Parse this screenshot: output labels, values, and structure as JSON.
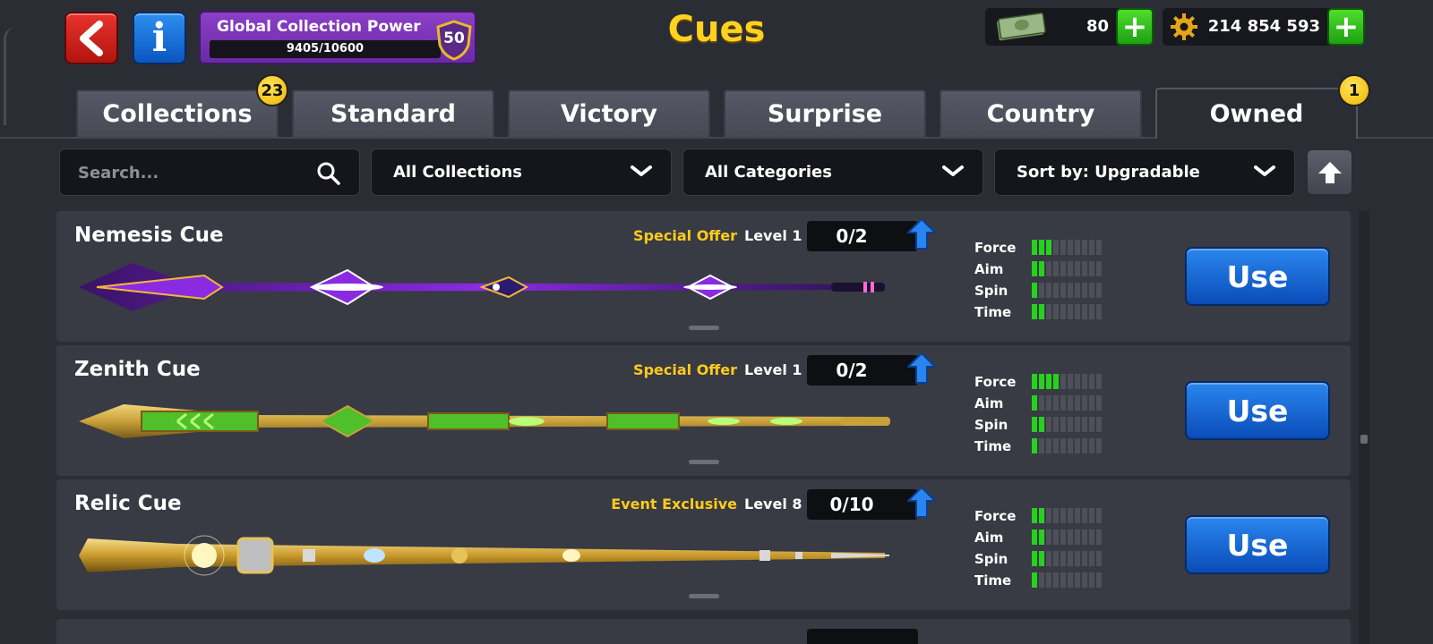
{
  "header": {
    "title": "Cues",
    "global_collection_power": {
      "label": "Global Collection Power",
      "progress_text": "9405/10600",
      "progress_fraction": 0.887,
      "level": "50"
    },
    "cash": {
      "value": "80",
      "icon": "cash-icon"
    },
    "coins": {
      "value": "214 854 593",
      "icon": "gear-coin-icon"
    }
  },
  "tabs": [
    {
      "label": "Collections",
      "badge": "23"
    },
    {
      "label": "Standard"
    },
    {
      "label": "Victory"
    },
    {
      "label": "Surprise"
    },
    {
      "label": "Country"
    },
    {
      "label": "Owned",
      "badge": "1",
      "active": true
    }
  ],
  "filters": {
    "search_placeholder": "Search...",
    "collection": "All Collections",
    "category": "All Categories",
    "sort": "Sort by: Upgradable"
  },
  "stat_labels": [
    "Force",
    "Aim",
    "Spin",
    "Time"
  ],
  "cues": [
    {
      "name": "Nemesis Cue",
      "offer": "Special Offer",
      "level": "Level 1",
      "progress": "0/2",
      "stats": {
        "force": 3,
        "aim": 2,
        "spin": 1,
        "time": 2
      },
      "action": "Use",
      "palette": {
        "main": "#8a2be2",
        "glow": "#ffffff",
        "accent": "#f0b63a"
      }
    },
    {
      "name": "Zenith Cue",
      "offer": "Special Offer",
      "level": "Level 1",
      "progress": "0/2",
      "stats": {
        "force": 4,
        "aim": 1,
        "spin": 2,
        "time": 1
      },
      "action": "Use",
      "palette": {
        "main": "#4fbf2a",
        "glow": "#b8ff7a",
        "accent": "#c9a13a"
      }
    },
    {
      "name": "Relic Cue",
      "offer": "Event Exclusive",
      "level": "Level 8",
      "progress": "0/10",
      "stats": {
        "force": 2,
        "aim": 2,
        "spin": 2,
        "time": 1
      },
      "action": "Use",
      "palette": {
        "main": "#c99a2c",
        "glow": "#fff6c0",
        "accent": "#e6c25a"
      }
    }
  ],
  "stat_max": 10,
  "colors": {
    "accent_yellow": "#ffd21f",
    "use_button": "#1a6adc",
    "stat_on": "#27d11e"
  }
}
